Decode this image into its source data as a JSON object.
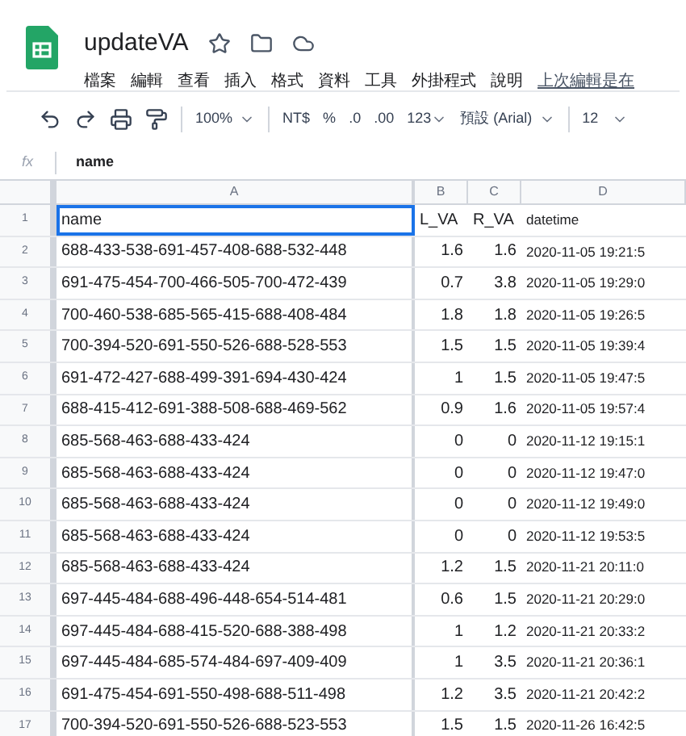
{
  "doc": {
    "title": "updateVA"
  },
  "menu": [
    "檔案",
    "編輯",
    "查看",
    "插入",
    "格式",
    "資料",
    "工具",
    "外掛程式",
    "說明",
    "上次編輯是在"
  ],
  "toolbar": {
    "zoom": "100%",
    "currency": "NT$",
    "percent": "%",
    "decrease_decimal": ".0",
    "increase_decimal": ".00",
    "number_format": "123",
    "font": "預設 (Arial)",
    "font_size": "12"
  },
  "formula_bar": {
    "label": "fx",
    "value": "name"
  },
  "columns": [
    {
      "label": "A"
    },
    {
      "label": "B"
    },
    {
      "label": "C"
    },
    {
      "label": "D"
    }
  ],
  "rows": [
    {
      "num": "1",
      "cells": [
        "name",
        "L_VA",
        "R_VA",
        "datetime"
      ],
      "selected": true
    },
    {
      "num": "2",
      "cells": [
        "688-433-538-691-457-408-688-532-448",
        "1.6",
        "1.6",
        "2020-11-05 19:21:5"
      ],
      "selected": false
    },
    {
      "num": "3",
      "cells": [
        "691-475-454-700-466-505-700-472-439",
        "0.7",
        "3.8",
        "2020-11-05 19:29:0"
      ],
      "selected": false
    },
    {
      "num": "4",
      "cells": [
        "700-460-538-685-565-415-688-408-484",
        "1.8",
        "1.8",
        "2020-11-05 19:26:5"
      ],
      "selected": false
    },
    {
      "num": "5",
      "cells": [
        "700-394-520-691-550-526-688-528-553",
        "1.5",
        "1.5",
        "2020-11-05 19:39:4"
      ],
      "selected": false
    },
    {
      "num": "6",
      "cells": [
        "691-472-427-688-499-391-694-430-424",
        "1",
        "1.5",
        "2020-11-05 19:47:5"
      ],
      "selected": false
    },
    {
      "num": "7",
      "cells": [
        "688-415-412-691-388-508-688-469-562",
        "0.9",
        "1.6",
        "2020-11-05 19:57:4"
      ],
      "selected": false
    },
    {
      "num": "8",
      "cells": [
        "685-568-463-688-433-424",
        "0",
        "0",
        "2020-11-12 19:15:1"
      ],
      "selected": false
    },
    {
      "num": "9",
      "cells": [
        "685-568-463-688-433-424",
        "0",
        "0",
        "2020-11-12 19:47:0"
      ],
      "selected": false
    },
    {
      "num": "10",
      "cells": [
        "685-568-463-688-433-424",
        "0",
        "0",
        "2020-11-12 19:49:0"
      ],
      "selected": false
    },
    {
      "num": "11",
      "cells": [
        "685-568-463-688-433-424",
        "0",
        "0",
        "2020-11-12 19:53:5"
      ],
      "selected": false
    },
    {
      "num": "12",
      "cells": [
        "685-568-463-688-433-424",
        "1.2",
        "1.5",
        "2020-11-21 20:11:0"
      ],
      "selected": false
    },
    {
      "num": "13",
      "cells": [
        "697-445-484-688-496-448-654-514-481",
        "0.6",
        "1.5",
        "2020-11-21 20:29:0"
      ],
      "selected": false
    },
    {
      "num": "14",
      "cells": [
        "697-445-484-688-415-520-688-388-498",
        "1",
        "1.2",
        "2020-11-21 20:33:2"
      ],
      "selected": false
    },
    {
      "num": "15",
      "cells": [
        "697-445-484-685-574-484-697-409-409",
        "1",
        "3.5",
        "2020-11-21 20:36:1"
      ],
      "selected": false
    },
    {
      "num": "16",
      "cells": [
        "691-475-454-691-550-498-688-511-498",
        "1.2",
        "3.5",
        "2020-11-21 20:42:2"
      ],
      "selected": false
    },
    {
      "num": "17",
      "cells": [
        "700-394-520-691-550-526-688-523-553",
        "1.5",
        "1.5",
        "2020-11-26 16:42:5"
      ],
      "selected": false
    }
  ]
}
